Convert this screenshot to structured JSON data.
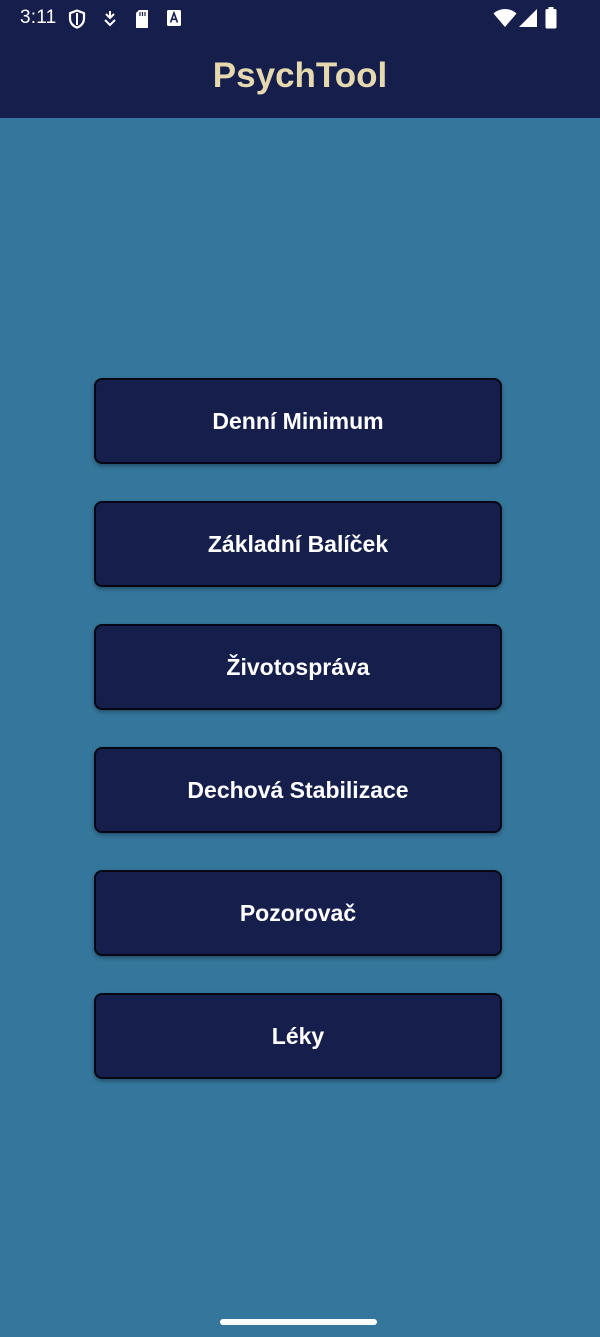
{
  "status_bar": {
    "time": "3:11",
    "left_icons": [
      "shield-icon",
      "download-icon",
      "sd-card-icon",
      "font-icon"
    ],
    "right_icons": [
      "wifi-icon",
      "signal-icon",
      "battery-icon"
    ]
  },
  "app_bar": {
    "title": "PsychTool"
  },
  "menu": {
    "items": [
      {
        "label": "Denní Minimum"
      },
      {
        "label": "Základní Balíček"
      },
      {
        "label": "Životospráva"
      },
      {
        "label": "Dechová Stabilizace"
      },
      {
        "label": "Pozorovač"
      },
      {
        "label": "Léky"
      }
    ]
  },
  "colors": {
    "app_bar_background": "#161f4c",
    "title_text": "#e6d9b0",
    "page_background": "#35779c",
    "button_background": "#161f4c",
    "button_text": "#ffffff"
  }
}
